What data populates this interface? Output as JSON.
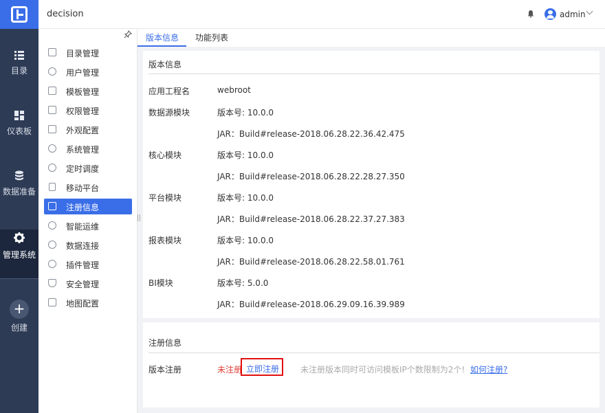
{
  "app": {
    "title": "decision",
    "user": "admin"
  },
  "rail": [
    {
      "label": "目录",
      "icon": "list-icon"
    },
    {
      "label": "仪表板",
      "icon": "dashboard-icon"
    },
    {
      "label": "数据准备",
      "icon": "database-icon"
    },
    {
      "label": "管理系统",
      "icon": "gear-icon"
    },
    {
      "label": "创建",
      "icon": "plus-icon"
    }
  ],
  "sidebar": {
    "items": [
      {
        "label": "目录管理"
      },
      {
        "label": "用户管理"
      },
      {
        "label": "模板管理"
      },
      {
        "label": "权限管理"
      },
      {
        "label": "外观配置"
      },
      {
        "label": "系统管理"
      },
      {
        "label": "定时调度"
      },
      {
        "label": "移动平台"
      },
      {
        "label": "注册信息"
      },
      {
        "label": "智能运维"
      },
      {
        "label": "数据连接"
      },
      {
        "label": "插件管理"
      },
      {
        "label": "安全管理"
      },
      {
        "label": "地图配置"
      }
    ],
    "active": "注册信息"
  },
  "tabs": [
    {
      "label": "版本信息"
    },
    {
      "label": "功能列表"
    }
  ],
  "version_card": {
    "title": "版本信息",
    "rows": [
      {
        "label": "应用工程名",
        "value": "webroot"
      },
      {
        "label": "数据源模块",
        "value": "版本号: 10.0.0"
      },
      {
        "label": "",
        "value": "JAR：Build#release-2018.06.28.22.36.42.475"
      },
      {
        "label": "核心模块",
        "value": "版本号: 10.0.0"
      },
      {
        "label": "",
        "value": "JAR：Build#release-2018.06.28.22.28.27.350"
      },
      {
        "label": "平台模块",
        "value": "版本号: 10.0.0"
      },
      {
        "label": "",
        "value": "JAR：Build#release-2018.06.28.22.37.27.383"
      },
      {
        "label": "报表模块",
        "value": "版本号: 10.0.0"
      },
      {
        "label": "",
        "value": "JAR：Build#release-2018.06.28.22.58.01.761"
      },
      {
        "label": "BI模块",
        "value": "版本号: 5.0.0"
      },
      {
        "label": "",
        "value": "JAR：Build#release-2018.06.29.09.16.39.989"
      }
    ]
  },
  "reg_card": {
    "title": "注册信息",
    "label": "版本注册",
    "status": "未注册",
    "register_now": "立即注册",
    "hint": "未注册版本同时可访问模板IP个数限制为2个!",
    "how_link": "如何注册?"
  },
  "colors": {
    "accent": "#3a6ee8",
    "rail_bg": "#2e3b55",
    "warning_red": "#e2403a"
  }
}
